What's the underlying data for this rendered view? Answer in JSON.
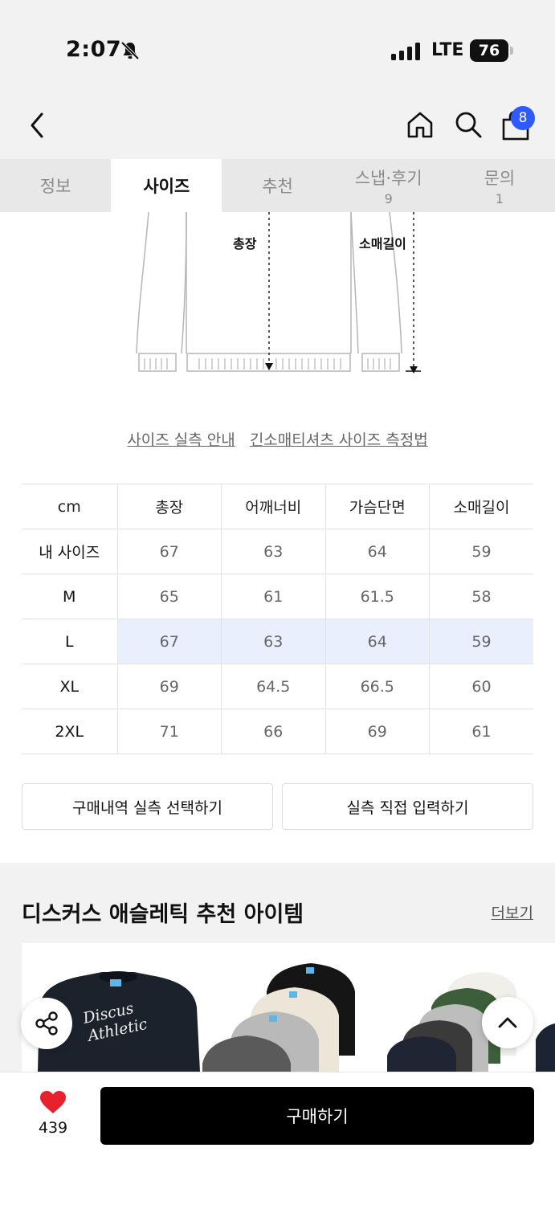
{
  "status_bar": {
    "time": "2:07",
    "network": "LTE",
    "battery": "76"
  },
  "nav": {
    "cart_count": "8"
  },
  "tabs": [
    {
      "label": "정보",
      "count": ""
    },
    {
      "label": "사이즈",
      "count": "",
      "active": true
    },
    {
      "label": "추천",
      "count": ""
    },
    {
      "label": "스냅·후기",
      "count": "9"
    },
    {
      "label": "문의",
      "count": "1"
    }
  ],
  "diagram": {
    "length_label": "총장",
    "sleeve_label": "소매길이"
  },
  "links": {
    "measure_guide": "사이즈 실측 안내",
    "method": "긴소매티셔츠 사이즈 측정법"
  },
  "size_table": {
    "headers": [
      "cm",
      "총장",
      "어깨너비",
      "가슴단면",
      "소매길이"
    ],
    "rows": [
      {
        "label": "내 사이즈",
        "values": [
          "67",
          "63",
          "64",
          "59"
        ]
      },
      {
        "label": "M",
        "values": [
          "65",
          "61",
          "61.5",
          "58"
        ]
      },
      {
        "label": "L",
        "values": [
          "67",
          "63",
          "64",
          "59"
        ],
        "highlight": true
      },
      {
        "label": "XL",
        "values": [
          "69",
          "64.5",
          "66.5",
          "60"
        ]
      },
      {
        "label": "2XL",
        "values": [
          "71",
          "66",
          "69",
          "61"
        ]
      }
    ]
  },
  "buttons": {
    "select_history": "구매내역 실측 선택하기",
    "direct_input": "실측 직접 입력하기"
  },
  "recommend": {
    "title": "디스커스 애슬레틱 추천 아이템",
    "more": "더보기",
    "product_logo_line1": "Discus",
    "product_logo_line2": "Athletic"
  },
  "bottom": {
    "likes": "439",
    "buy": "구매하기"
  },
  "colors": {
    "accent_blue": "#2d5bff",
    "highlight_row": "#e9effc",
    "heart": "#e8222c"
  }
}
